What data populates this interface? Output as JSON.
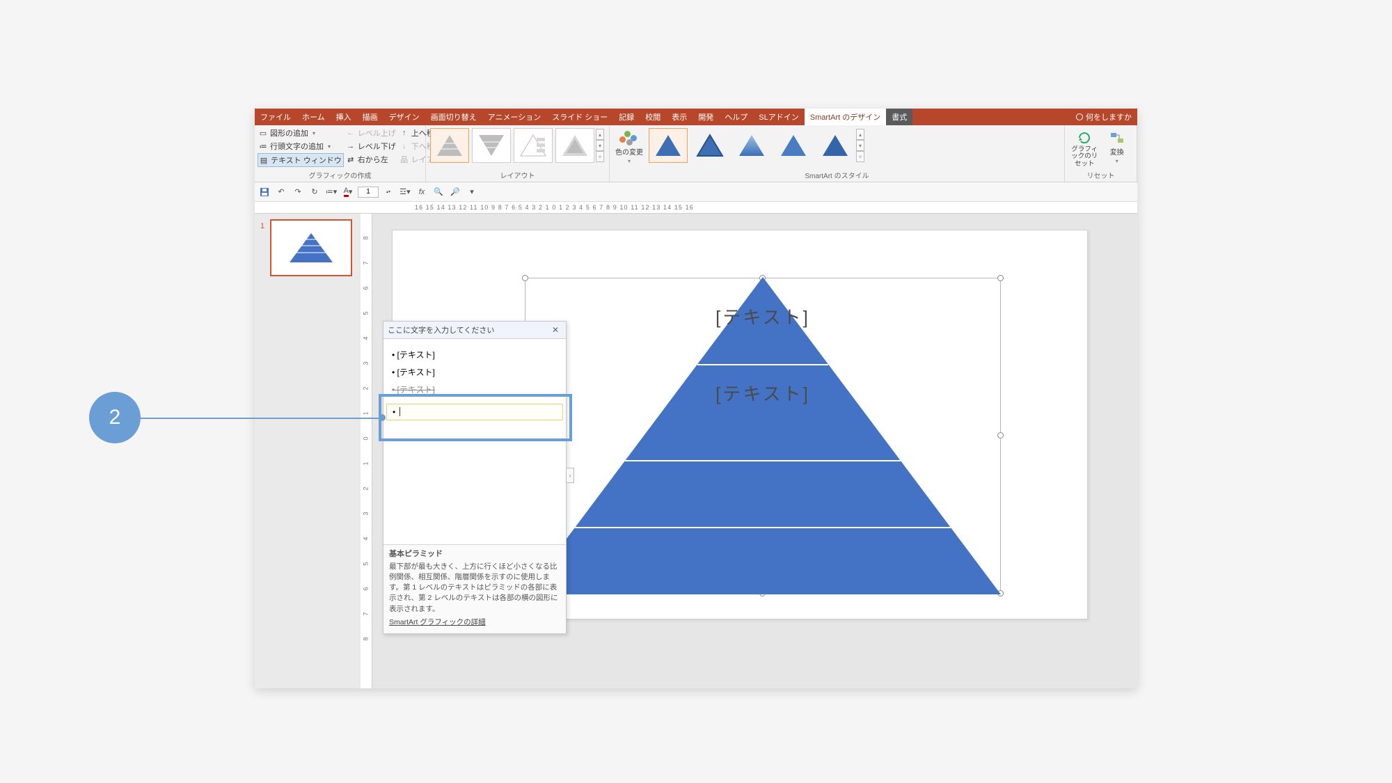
{
  "annotation": {
    "step": "2"
  },
  "ribbon": {
    "tabs": {
      "file": "ファイル",
      "home": "ホーム",
      "insert": "挿入",
      "draw": "描画",
      "design": "デザイン",
      "transitions": "画面切り替え",
      "animations": "アニメーション",
      "slideshow": "スライド ショー",
      "record": "記録",
      "review": "校閲",
      "view": "表示",
      "developer": "開発",
      "help": "ヘルプ",
      "sladdin": "SLアドイン",
      "smartart_design": "SmartArt のデザイン",
      "format": "書式",
      "tell_me": "何をしますか"
    },
    "groups": {
      "create": {
        "add_shape": "図形の追加",
        "add_bullet": "行頭文字の追加",
        "text_window": "テキスト ウィンドウ",
        "level_up": "レベル上げ",
        "level_down": "レベル下げ",
        "rtl": "右から左",
        "move_up": "上へ移動",
        "move_down": "下へ移動",
        "layout_btn": "レイアウト",
        "label": "グラフィックの作成"
      },
      "layout": {
        "label": "レイアウト"
      },
      "styles": {
        "color_change": "色の変更",
        "label": "SmartArt のスタイル"
      },
      "reset": {
        "reset_graphic": "グラフィックのリセット",
        "convert": "変換",
        "label": "リセット"
      }
    }
  },
  "qat": {
    "fontsize": "1"
  },
  "ruler_h": "16  15  14  13  12  11  10  9  8  7  6  5  4  3  2  1  0  1  2  3  4  5  6  7  8  9  10  11  12  13  14  15  16",
  "ruler_v": [
    "8",
    "7",
    "6",
    "5",
    "4",
    "3",
    "2",
    "1",
    "0",
    "1",
    "2",
    "3",
    "4",
    "5",
    "6",
    "7",
    "8"
  ],
  "thumbs": {
    "slide1": "1"
  },
  "pyramid": {
    "text1": "[テキスト]",
    "text2": "[テキスト]"
  },
  "text_pane": {
    "title": "ここに文字を入力してください",
    "items": [
      "[テキスト]",
      "[テキスト]",
      "[テキスト]"
    ],
    "new_item_prefix": "• ",
    "info_title": "基本ピラミッド",
    "info_body": "最下部が最も大きく、上方に行くほど小さくなる比例関係、相互関係、階層関係を示すのに使用します。第 1 レベルのテキストはピラミッドの各部に表示され、第 2 レベルのテキストは各部の横の図形に表示されます。",
    "info_link": "SmartArt グラフィックの詳細"
  }
}
